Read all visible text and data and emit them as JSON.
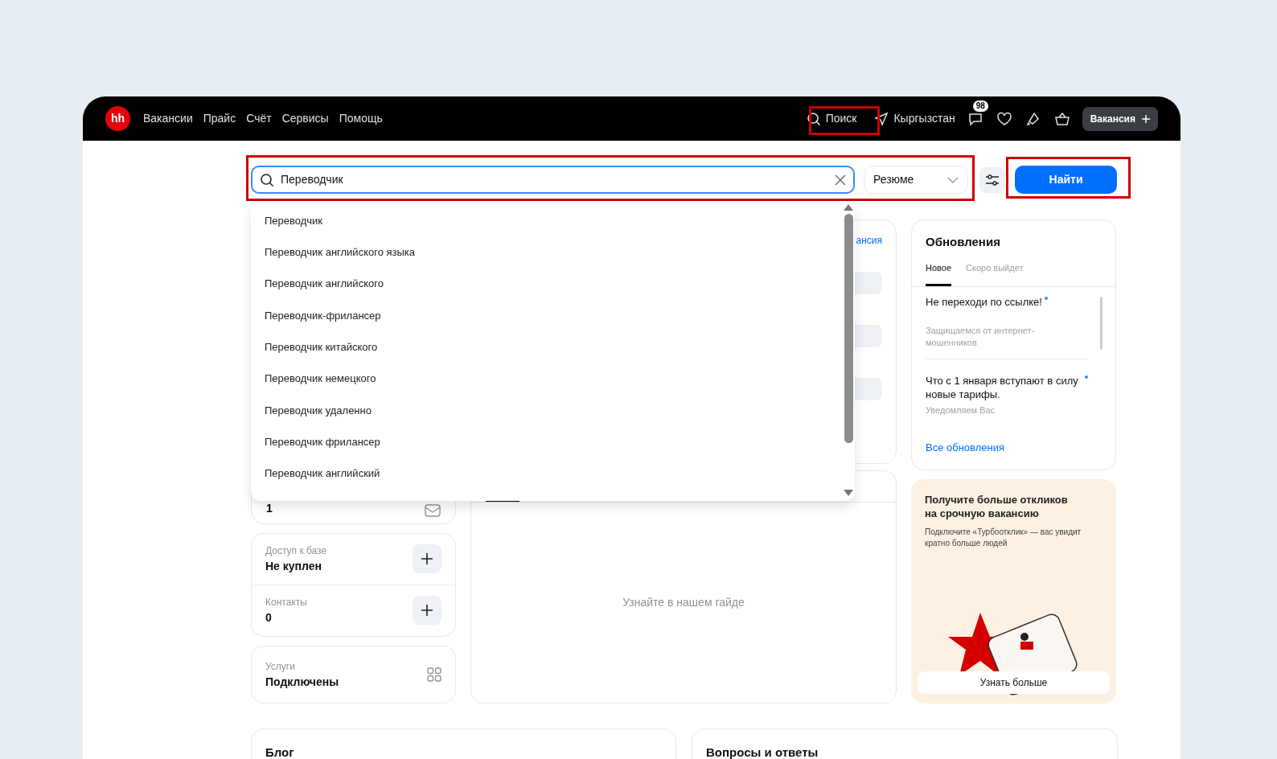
{
  "header": {
    "logo": "hh",
    "nav": [
      "Вакансии",
      "Прайс",
      "Счёт",
      "Сервисы",
      "Помощь"
    ],
    "search_link": "Поиск",
    "region": "Кыргызстан",
    "chat_badge": "98",
    "post_button": "Вакансия"
  },
  "search": {
    "value": "Переводчик",
    "type_select": "Резюме",
    "submit": "Найти"
  },
  "suggestions": [
    "Переводчик",
    "Переводчик английского языка",
    "Переводчик английского",
    "Переводчик-фрилансер",
    "Переводчик китайского",
    "Переводчик немецкого",
    "Переводчик удаленно",
    "Переводчик фрилансер",
    "Переводчик английский"
  ],
  "left_cards": {
    "hidden_value": "1",
    "database": {
      "label": "Доступ к базе",
      "value": "Не куплен"
    },
    "contacts": {
      "label": "Контакты",
      "value": "0"
    },
    "services": {
      "label": "Услуги",
      "value": "Подключены"
    }
  },
  "middle": {
    "partial_link": "ансия",
    "guide_text": "Узнайте в нашем гайде"
  },
  "updates": {
    "title": "Обновления",
    "tabs": [
      {
        "label": "Новое",
        "selected": true
      },
      {
        "label": "Скоро выйдет",
        "selected": false
      }
    ],
    "items": [
      {
        "title": "Не переходи по ссылке!",
        "unread": true,
        "subtitle": "Защищаемся от интернет-мошенников"
      },
      {
        "title": "Что с 1 января вступают в силу новые тарифы.",
        "unread": true,
        "subtitle": "Уведомляем Вас"
      }
    ],
    "all_link": "Все обновления"
  },
  "promo": {
    "title": "Получите больше откликов на срочную вакансию",
    "text": "Подключите «Турбоотклик» — вас увидит кратно больше людей",
    "button": "Узнать больше"
  },
  "bottom": [
    "Блог",
    "Вопросы и ответы"
  ]
}
